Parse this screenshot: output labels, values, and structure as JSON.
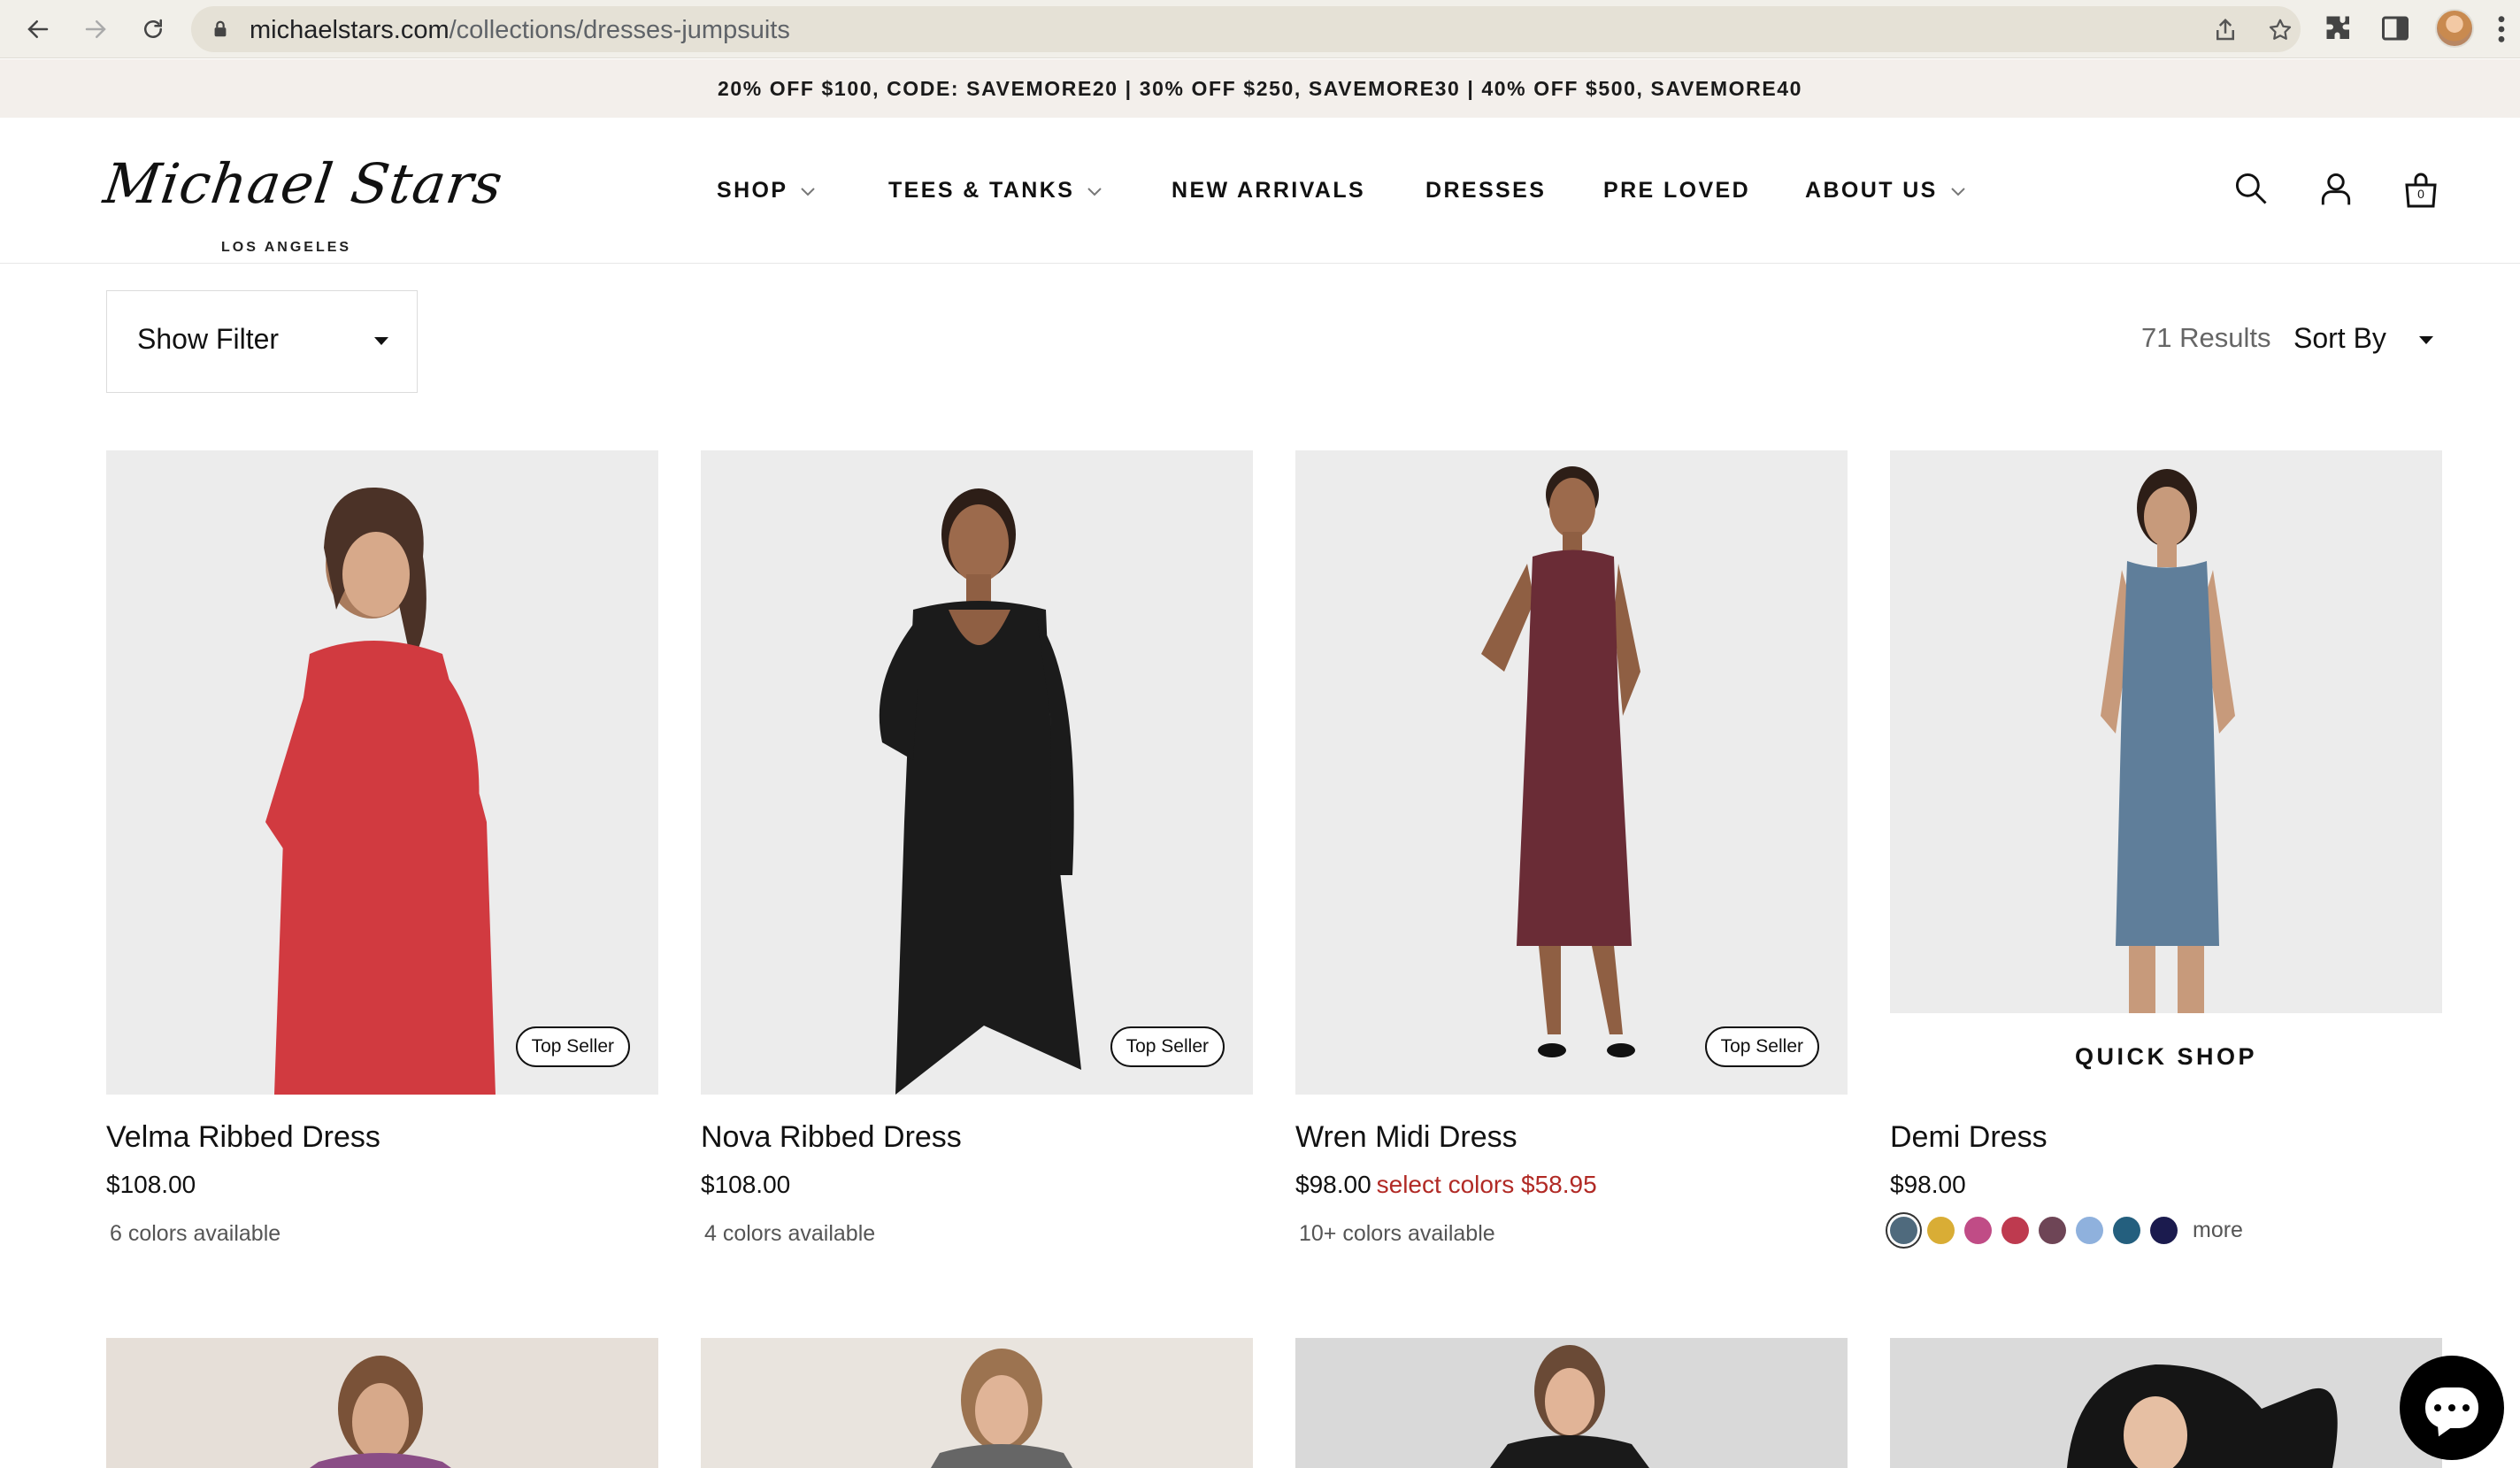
{
  "browser": {
    "url_domain": "michaelstars.com",
    "url_path": "/collections/dresses-jumpsuits"
  },
  "promo": {
    "text": "20% OFF $100, CODE: SAVEMORE20 | 30% OFF $250, SAVEMORE30 | 40% OFF $500, SAVEMORE40"
  },
  "header": {
    "logo_script": "Michael Stars",
    "logo_sub": "LOS ANGELES",
    "nav": [
      {
        "label": "SHOP",
        "has_dropdown": true
      },
      {
        "label": "TEES & TANKS",
        "has_dropdown": true
      },
      {
        "label": "NEW ARRIVALS",
        "has_dropdown": false
      },
      {
        "label": "DRESSES",
        "has_dropdown": false
      },
      {
        "label": "PRE LOVED",
        "has_dropdown": false
      },
      {
        "label": "ABOUT US",
        "has_dropdown": true
      }
    ],
    "icons": [
      "search-icon",
      "account-icon",
      "cart-icon"
    ],
    "cart_count": "0"
  },
  "toolbar": {
    "filter_label": "Show Filter",
    "results": "71 Results",
    "sort_label": "Sort By"
  },
  "products": [
    {
      "name": "Velma Ribbed Dress",
      "price": "$108.00",
      "sale": "",
      "colors_text": "6 colors available",
      "badge": "Top Seller",
      "dress_color": "#d13a40"
    },
    {
      "name": "Nova Ribbed Dress",
      "price": "$108.00",
      "sale": "",
      "colors_text": "4 colors available",
      "badge": "Top Seller",
      "dress_color": "#1b1b1b"
    },
    {
      "name": "Wren Midi Dress",
      "price": "$98.00",
      "sale": "select colors $58.95",
      "colors_text": "10+ colors available",
      "badge": "Top Seller",
      "dress_color": "#6a2c36"
    },
    {
      "name": "Demi Dress",
      "price": "$98.00",
      "sale": "",
      "quick_shop": "QUICK SHOP",
      "swatches": [
        "#4f6a7d",
        "#d9ad35",
        "#c04c86",
        "#be3a4f",
        "#6e4556",
        "#8fb1dd",
        "#245f7e",
        "#1b1b4e"
      ],
      "more": "more",
      "dress_color": "#5f7e9a"
    }
  ],
  "row2_dress_colors": [
    "#8a4d86",
    "#666666",
    "#1a1a1a",
    "#151515"
  ],
  "chat": {
    "icon": "chat-icon"
  }
}
